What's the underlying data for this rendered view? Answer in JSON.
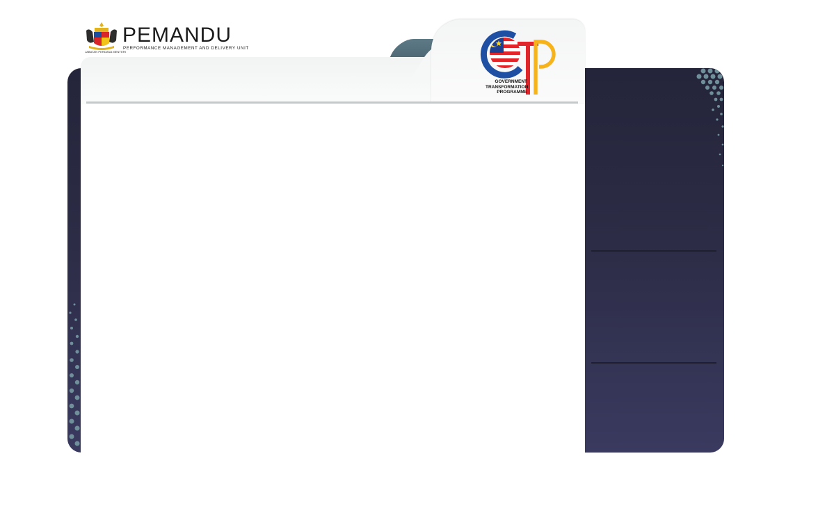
{
  "header": {
    "brand_title": "PEMANDU",
    "brand_subtitle": "PERFORMANCE MANAGEMENT AND DELIVERY UNIT",
    "crest_caption": "JABATAN PERDANA MENTERI",
    "gtp_logo": {
      "lines": [
        "GOVERNMENT",
        "TRANSFORMATION",
        "PROGRAMME"
      ],
      "colors": {
        "blue": "#1f4fa3",
        "red": "#e0262b",
        "yellow": "#f6b31a"
      }
    }
  },
  "theme": {
    "panel_dark": "#2c2c46",
    "tab_teal": "#4d6a75",
    "rule_grey": "#c6c9ca"
  },
  "icons": {
    "crest": "malaysia-coat-of-arms-icon",
    "gtp": "gtp-globe-logo-icon"
  }
}
